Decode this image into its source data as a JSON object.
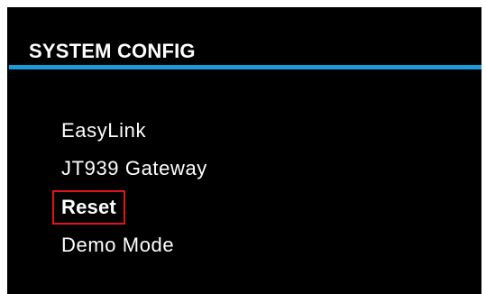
{
  "header": {
    "title": "SYSTEM CONFIG",
    "rule_color": "#1a9bd7"
  },
  "menu": {
    "items": [
      {
        "label": "EasyLink",
        "selected": false
      },
      {
        "label": "JT939 Gateway",
        "selected": false
      },
      {
        "label": "Reset",
        "selected": true
      },
      {
        "label": "Demo Mode",
        "selected": false
      }
    ],
    "highlight_color": "#e3141c"
  }
}
